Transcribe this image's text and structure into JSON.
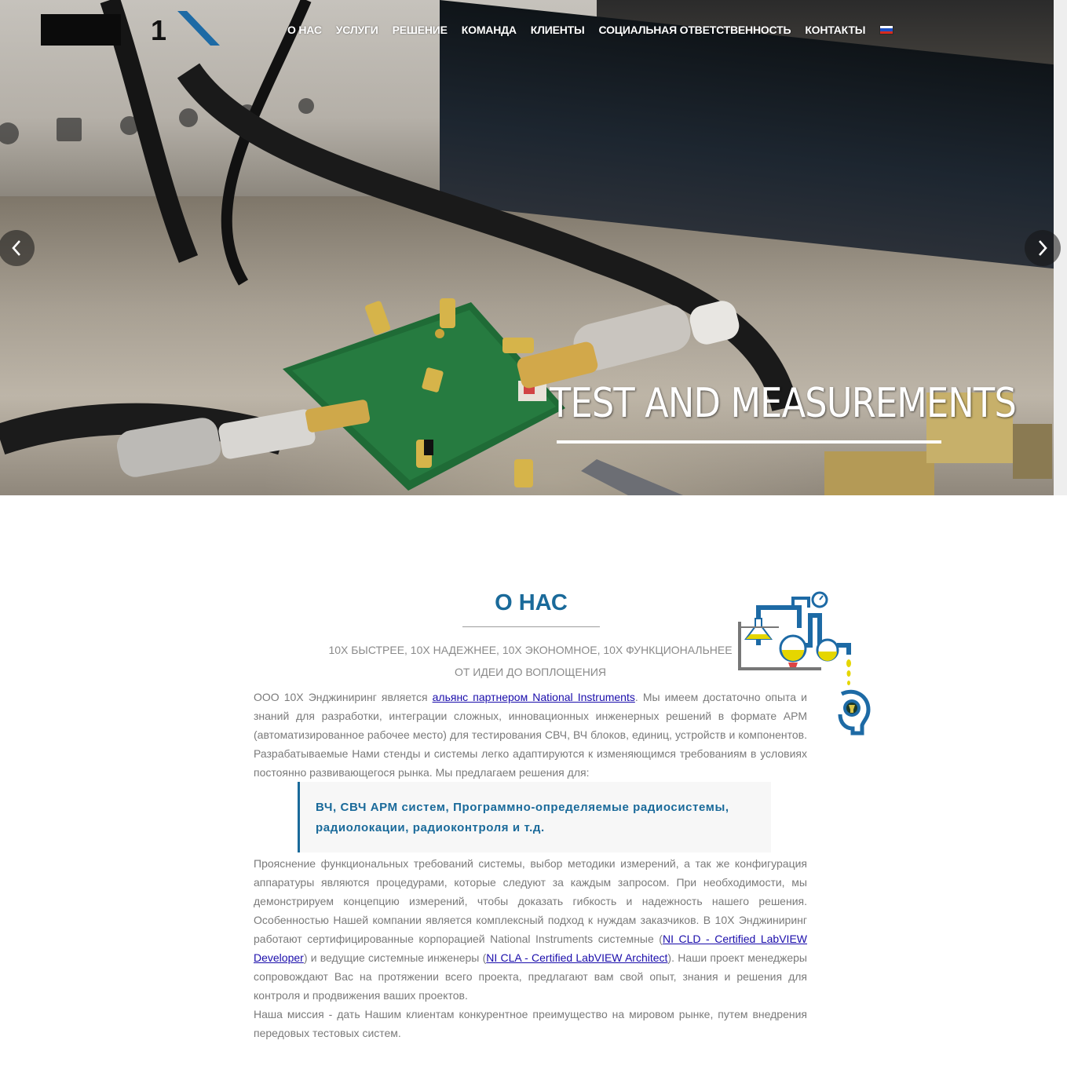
{
  "nav": {
    "items": [
      "О НАС",
      "УСЛУГИ",
      "РЕШЕНИЕ",
      "КОМАНДА",
      "КЛИЕНТЫ",
      "СОЦИАЛЬНАЯ ОТВЕТСТВЕННОСТЬ",
      "КОНТАКТЫ"
    ],
    "language_flag": "ru-flag-icon"
  },
  "logo": {
    "text": "1"
  },
  "hero": {
    "title": "TEST AND MEASUREMENTS",
    "prev_icon": "chevron-left-icon",
    "next_icon": "chevron-right-icon"
  },
  "about": {
    "title": "О НАС",
    "subtitle1": "10X БЫСТРЕЕ, 10X НАДЕЖНЕЕ, 10X ЭКОНОМНОЕ, 10X ФУНКЦИОНАЛЬНЕЕ",
    "subtitle2": "ОТ ИДЕИ ДО ВОПЛОЩЕНИЯ",
    "p1_before": "ООО 10Х Энджиниринг является ",
    "p1_link": "альянс партнером National Instruments",
    "p1_after": ". Мы имеем достаточно опыта и знаний для разработки, интеграции сложных, инновационных инженерных решений в формате АРМ (автоматизированное рабочее место) для тестирования СВЧ, ВЧ блоков, единиц, устройств и компонентов. Разрабатываемые Нами стенды и системы легко адаптируются к изменяющимся требованиям в условиях постоянно развивающегося рынка. Мы предлагаем решения для:",
    "quote": "ВЧ, СВЧ АРМ систем, Программно-определяемые радиосистемы, радиолокации, радиоконтроля и т.д.",
    "p2_part1": "Прояснение функциональных требований системы, выбор методики измерений, а так же конфигурация аппаратуры являются процедурами, которые следуют за каждым запросом. При необходимости, мы демонстрируем концепцию измерений, чтобы доказать гибкость и надежность нашего решения. Особенностью Нашей компании является комплексный подход к нуждам заказчиков. В 10Х Энджиниринг работают сертифицированные корпорацией National Instruments системные (",
    "p2_link1": "NI CLD - Certified LabVIEW Developer",
    "p2_part2": ") и ведущие системные инженеры (",
    "p2_link2": "NI CLA - Certified LabVIEW Architect",
    "p2_part3": "). Наши проект менеджеры сопровождают Вас на протяжении всего проекта, предлагают вам свой опыт, знания и решения для контроля и продвижения ваших проектов.",
    "p3": "Наша миссия - дать Нашим клиентам конкурентное преимущество на мировом рынке, путем внедрения передовых тестовых систем.",
    "illustration_icon": "lab-equipment-illustration"
  },
  "colors": {
    "accent": "#1a6a9a",
    "link": "#1a0dab",
    "body_text": "#7a7a7a"
  }
}
